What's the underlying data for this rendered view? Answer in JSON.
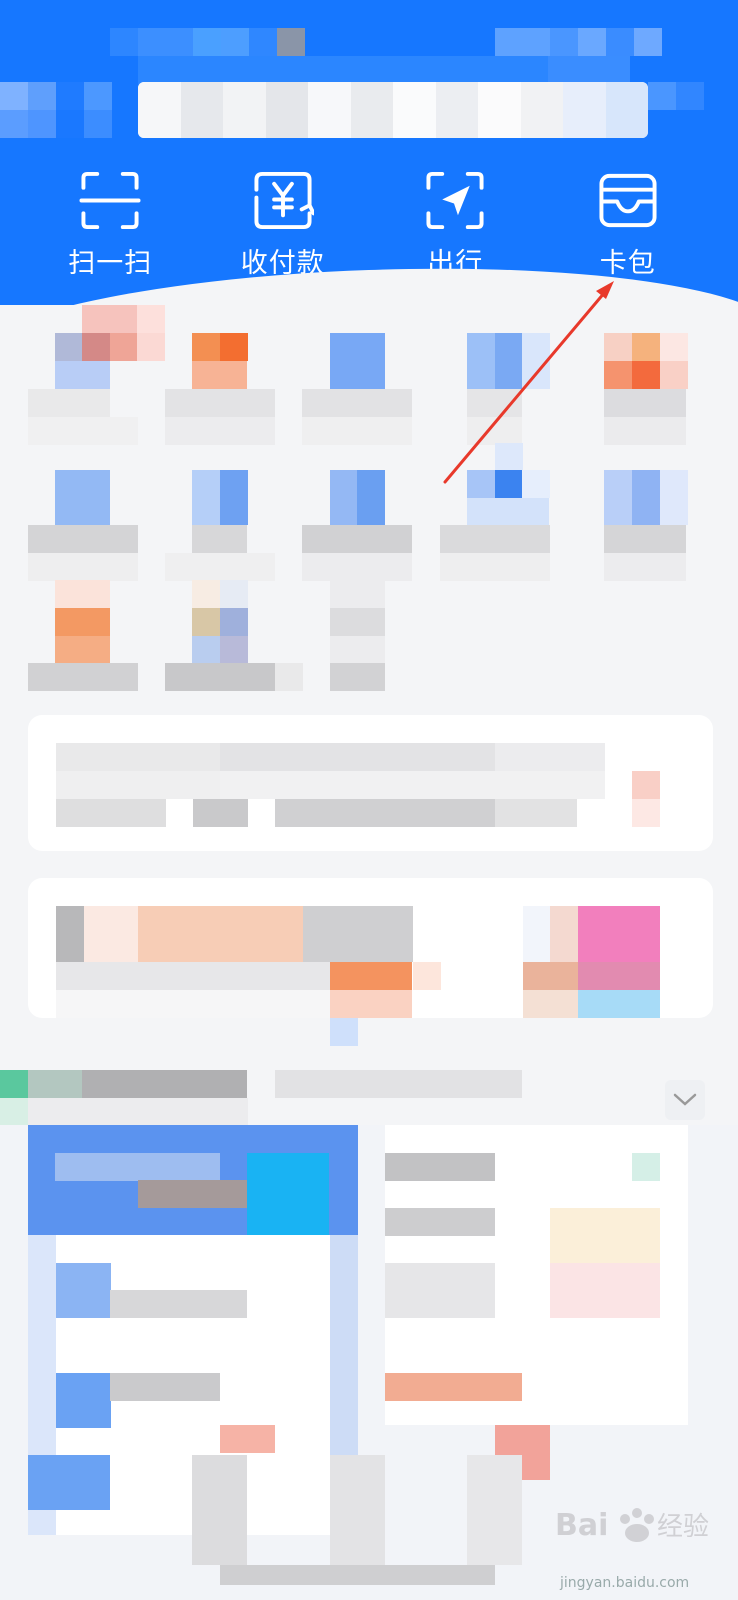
{
  "header": {
    "bg_color": "#1677ff",
    "quick_actions": [
      {
        "label": "扫一扫",
        "icon": "scan-icon"
      },
      {
        "label": "收付款",
        "icon": "payment-code-icon"
      },
      {
        "label": "出行",
        "icon": "travel-icon"
      },
      {
        "label": "卡包",
        "icon": "card-wallet-icon"
      }
    ]
  },
  "annotation": {
    "color": "#e8392b"
  },
  "watermark": {
    "logo": "baidu-jingyan-logo",
    "text": "jingyan.baidu.com"
  }
}
